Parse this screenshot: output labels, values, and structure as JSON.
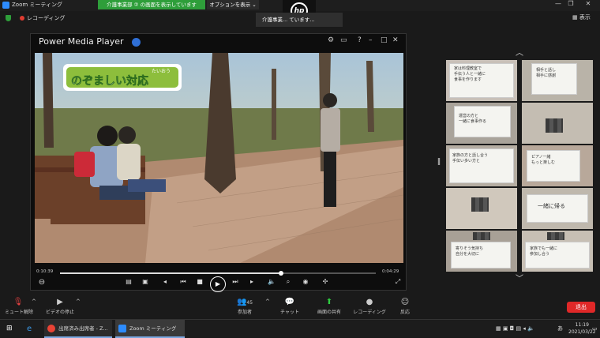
{
  "window": {
    "title": "Zoom ミーティング"
  },
  "share_bar": {
    "text": "介護事業部 ② の画面を表示しています",
    "options_label": "オプションを表示 ⌄"
  },
  "tooltip": {
    "text": "介護事業... ています..."
  },
  "recording": {
    "label": "レコーディング"
  },
  "view": {
    "label": "表示"
  },
  "player": {
    "title": "Power Media Player",
    "caption_ruby": "たいおう",
    "caption": "のぞましい対応",
    "time_current": "0:10:39",
    "time_total": "0:04:29",
    "progress": 0.7
  },
  "gallery": {
    "tiles": [
      {
        "text": "家は料理教室で\n手伝う人と一緒に\n食事を作ります"
      },
      {
        "text": "相手と話し\n相手に感謝"
      },
      {
        "text": "運営の方と\n一緒に食事作る"
      },
      {
        "text": ""
      },
      {
        "text": "家族の方と話し合う\n手伝い多い方と"
      },
      {
        "text": "ピアノ一緒\nもっと楽しむ"
      },
      {
        "text": ""
      },
      {
        "text": "一緒に帰る"
      },
      {
        "text": "寄りそう気持ち\n自分を大切に"
      },
      {
        "text": "家族でも一緒に\n参加し合う"
      }
    ]
  },
  "toolbar": {
    "mute": "ミュート解除",
    "video": "ビデオの停止",
    "participants": "参加者",
    "participants_count": "45",
    "chat": "チャット",
    "share": "画面の共有",
    "record": "レコーディング",
    "reactions": "反応",
    "leave": "退出"
  },
  "taskbar": {
    "chrome_task": "出席済み出席者 - Z...",
    "zoom_task": "Zoom ミーティング",
    "time": "11:19",
    "date": "2021/03/22",
    "ime": "あ"
  },
  "colors": {
    "share_green": "#2e9e3a",
    "leave_red": "#e02828",
    "zoom_blue": "#2d8cff"
  }
}
